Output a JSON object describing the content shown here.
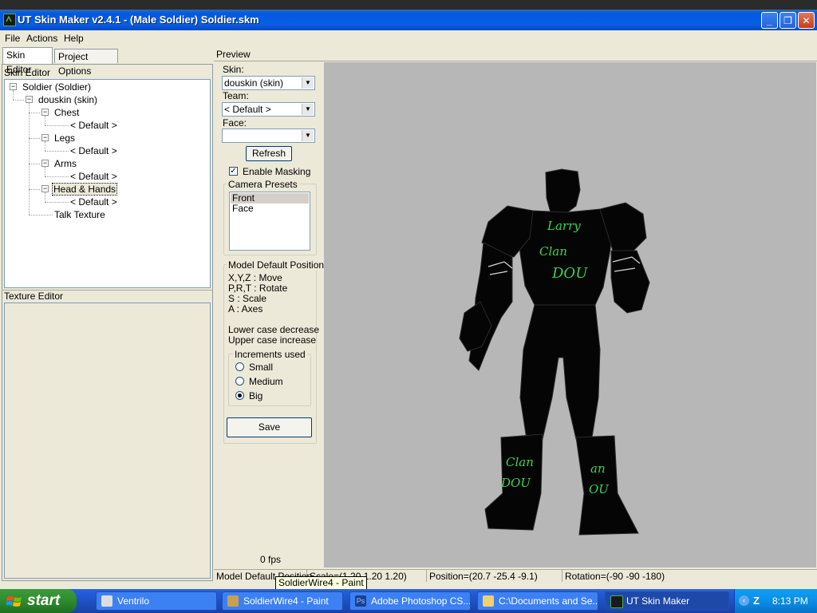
{
  "window": {
    "title": "UT Skin Maker v2.4.1 - (Male Soldier) Soldier.skm",
    "controls": {
      "minimize": "_",
      "maximize": "❐",
      "close": "✕"
    }
  },
  "menu": [
    "File",
    "Actions",
    "Help"
  ],
  "left_tabs": [
    "Skin Editor",
    "Project Options"
  ],
  "skin_editor": {
    "group_label": "Skin Editor",
    "tree": {
      "root": "Soldier (Soldier)",
      "skin": "douskin (skin)",
      "parts": [
        {
          "label": "Chest",
          "child": "< Default >"
        },
        {
          "label": "Legs",
          "child": "< Default >"
        },
        {
          "label": "Arms",
          "child": "< Default >"
        },
        {
          "label": "Head & Hands",
          "child": "< Default >"
        }
      ],
      "talk": "Talk Texture"
    }
  },
  "texture_editor": {
    "group_label": "Texture Editor"
  },
  "preview": {
    "label": "Preview",
    "skin_label": "Skin:",
    "skin_value": "douskin (skin)",
    "team_label": "Team:",
    "team_value": "< Default >",
    "face_label": "Face:",
    "face_value": "",
    "refresh": "Refresh",
    "enable_masking": "Enable Masking",
    "camera_presets_label": "Camera Presets",
    "camera_presets": [
      "Front",
      "Face"
    ],
    "camera_selected": "Front",
    "model_default_label": "Model Default Position",
    "help_lines": [
      "X,Y,Z : Move",
      "P,R,T : Rotate",
      "S : Scale",
      "A : Axes"
    ],
    "case_lines": [
      "Lower case decrease",
      "Upper case increase"
    ],
    "increments_label": "Increments used",
    "increments": [
      "Small",
      "Medium",
      "Big"
    ],
    "increment_selected": "Big",
    "save": "Save",
    "fps": "0 fps",
    "model_text": {
      "chest": [
        "Larry",
        "Clan",
        "DOU"
      ],
      "left_leg": [
        "Clan",
        "DOU"
      ],
      "right_leg": [
        "an",
        "OU"
      ]
    }
  },
  "status": {
    "mode": "Model Default Position",
    "scale": "Scale=(1.20 1.20 1.20)",
    "position": "Position=(20.7 -25.4 -9.1)",
    "rotation": "Rotation=(-90 -90 -180)",
    "tooltip": "SoldierWire4 - Paint"
  },
  "taskbar": {
    "start": "start",
    "tasks": [
      "Ventrilo",
      "SoldierWire4 - Paint",
      "Adobe Photoshop CS...",
      "C:\\Documents and Se...",
      "UT Skin Maker"
    ],
    "clock": "8:13 PM"
  },
  "colors": {
    "accent_green": "#39d353",
    "viewport_bg": "#b7b7b7",
    "xp_blue": "#245edb"
  }
}
